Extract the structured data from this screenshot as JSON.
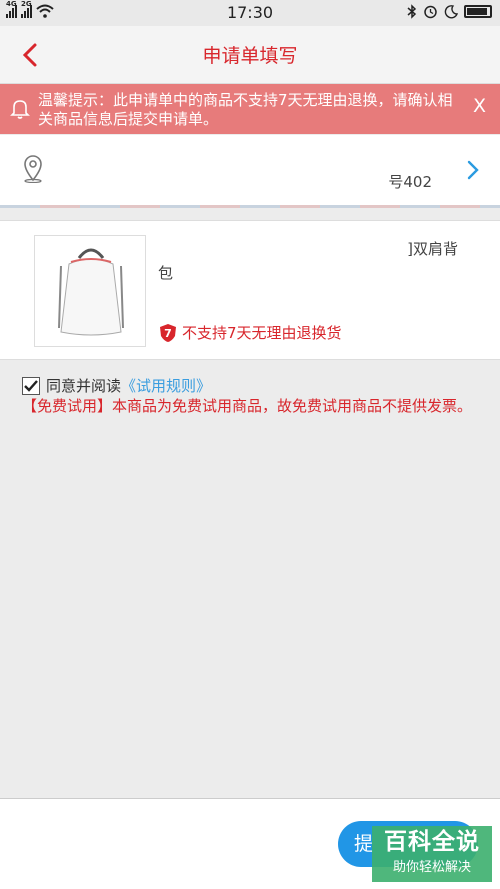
{
  "status_bar": {
    "time": "17:30",
    "network_1": "4G",
    "network_2": "2G"
  },
  "header": {
    "title": "申请单填写"
  },
  "notice": {
    "text": "温馨提示：此申请单中的商品不支持7天无理由退换，请确认相关商品信息后提交申请单。",
    "close_label": "X"
  },
  "address": {
    "text": "号402"
  },
  "product": {
    "name_line1": "]双肩背",
    "name_line2": "包",
    "policy_badge": "7",
    "policy_text": "不支持7天无理由退换货"
  },
  "agreement": {
    "checked": true,
    "label": "同意并阅读",
    "link": "《试用规则》",
    "free_note": "【免费试用】本商品为免费试用商品，故免费试用商品不提供发票。"
  },
  "footer": {
    "submit_label": "提"
  },
  "watermark": {
    "main": "百科全说",
    "sub": "助你轻松解决"
  },
  "colors": {
    "accent_red": "#d8262c",
    "notice_bg": "#e77b7b",
    "link_blue": "#3a9ddf",
    "button_blue": "#2196e6"
  }
}
